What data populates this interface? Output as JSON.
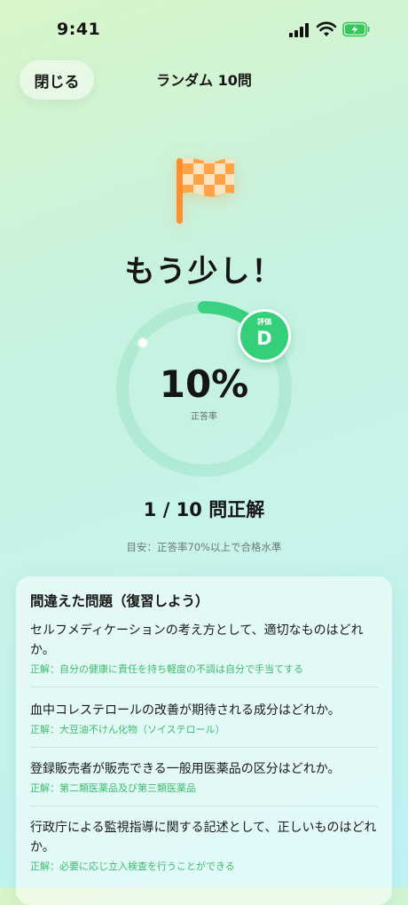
{
  "status_bar": {
    "time": "9:41"
  },
  "nav": {
    "close_label": "閉じる",
    "title": "ランダム 10問"
  },
  "result": {
    "headline": "もう少し！",
    "percent": "10%",
    "percent_value": 10,
    "percent_label": "正答率",
    "grade_label": "評価",
    "grade": "D",
    "score_line": "1 / 10 問正解",
    "hint": "目安：正答率70%以上で合格水準"
  },
  "review": {
    "title": "間違えた問題（復習しよう）",
    "items": [
      {
        "question": "セルフメディケーションの考え方として、適切なものはどれか。",
        "answer": "正解：自分の健康に責任を持ち軽度の不調は自分で手当てする"
      },
      {
        "question": "血中コレステロールの改善が期待される成分はどれか。",
        "answer": "正解：大豆油不けん化物（ソイステロール）"
      },
      {
        "question": "登録販売者が販売できる一般用医薬品の区分はどれか。",
        "answer": "正解：第二類医薬品及び第三類医薬品"
      },
      {
        "question": "行政庁による監視指導に関する記述として、正しいものはどれか。",
        "answer": "正解：必要に応じ立入検査を行うことができる"
      }
    ]
  },
  "colors": {
    "accent_green": "#33cf79",
    "flag_orange": "#ff9a3c",
    "answer_green": "#3dbb6e"
  }
}
